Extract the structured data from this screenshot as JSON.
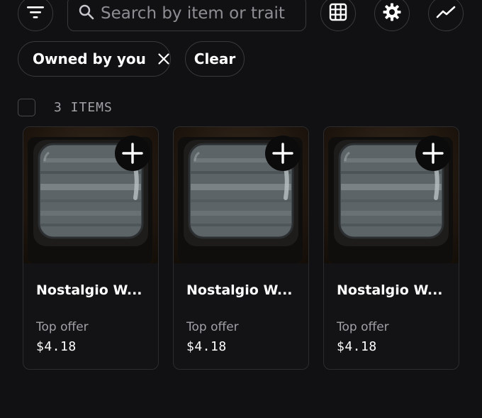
{
  "toolbar": {
    "filter_icon": "filter-lines-icon",
    "search": {
      "placeholder": "Search by item or trait",
      "value": "",
      "icon": "search-icon"
    },
    "grid_icon": "grid-view-icon",
    "settings_icon": "gear-icon",
    "activity_icon": "trend-line-icon"
  },
  "filters": {
    "chips": [
      {
        "label": "Owned by you",
        "icon": "close-icon"
      }
    ],
    "clear_label": "Clear"
  },
  "results": {
    "count_label": "3 ITEMS",
    "select_all_checked": false
  },
  "items": [
    {
      "name": "Nostalgio W...",
      "offer_label": "Top offer",
      "price": "$4.18",
      "add_icon": "plus-icon",
      "image": "crt-tv-static"
    },
    {
      "name": "Nostalgio W...",
      "offer_label": "Top offer",
      "price": "$4.18",
      "add_icon": "plus-icon",
      "image": "crt-tv-static"
    },
    {
      "name": "Nostalgio W...",
      "offer_label": "Top offer",
      "price": "$4.18",
      "add_icon": "plus-icon",
      "image": "crt-tv-static"
    }
  ],
  "colors": {
    "background": "#111113",
    "border": "#3a3a3c",
    "muted_text": "#a1a1a6",
    "placeholder_text": "#8e8e93"
  }
}
